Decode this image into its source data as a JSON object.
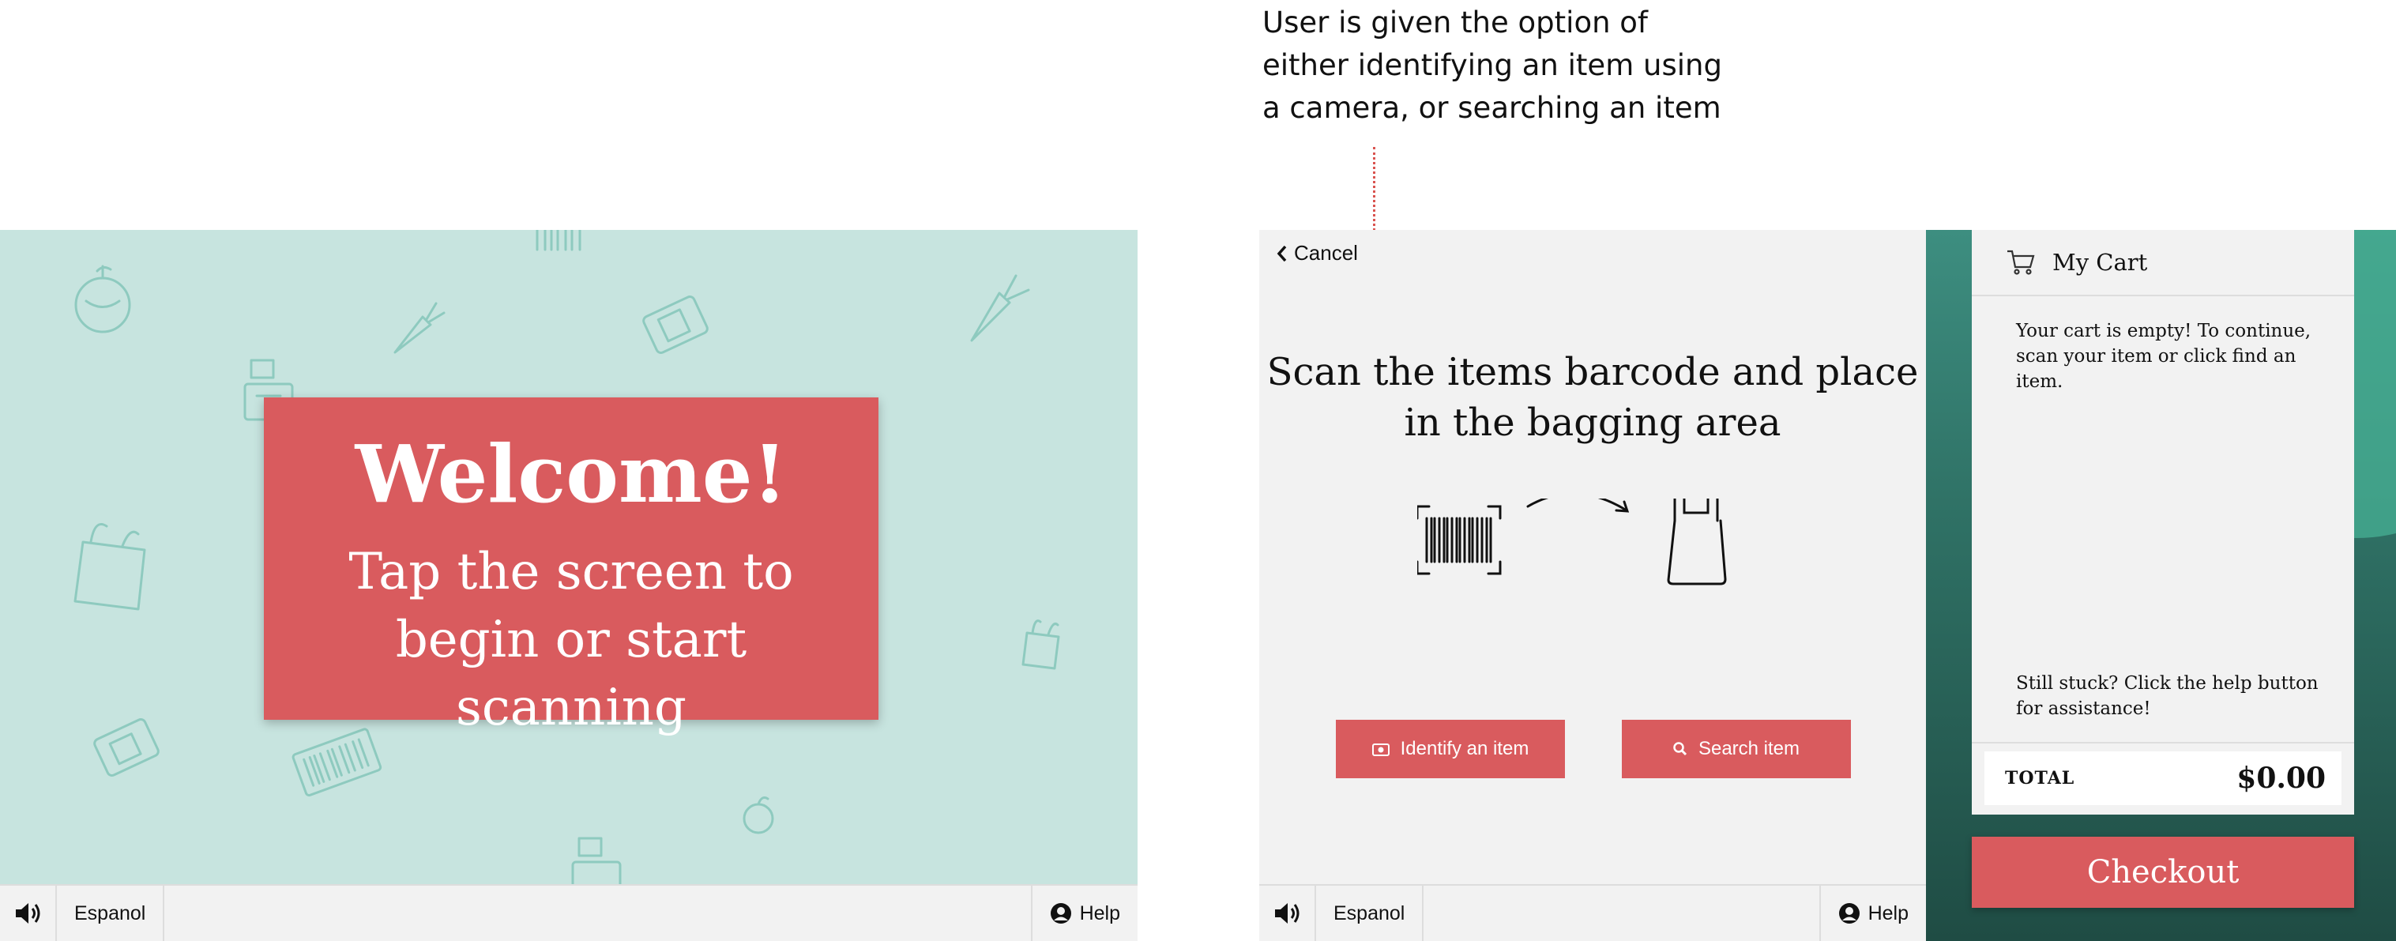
{
  "annotation": {
    "text": "User is given the option of either identifying an item using a camera, or searching an item"
  },
  "welcome_screen": {
    "title": "Welcome!",
    "subtitle": "Tap the screen to begin or start scanning",
    "background_color": "#c7e4df",
    "card_color": "#d95b5e",
    "footer": {
      "language_label": "Espanol",
      "help_label": "Help"
    }
  },
  "scan_screen": {
    "cancel_label": "Cancel",
    "instruction": "Scan the items barcode and place in the bagging area",
    "identify_button_label": "Identify an item",
    "search_button_label": "Search item",
    "accent_color": "#d95b5e",
    "footer": {
      "language_label": "Espanol",
      "help_label": "Help"
    },
    "cart": {
      "title": "My Cart",
      "empty_message": "Your cart is empty! To continue, scan your item or click find an item.",
      "help_message": "Still stuck? Click the help button for assistance!",
      "total_label": "TOTAL",
      "total_amount": "$0.00",
      "checkout_label": "Checkout"
    }
  },
  "icons": [
    "speaker-icon",
    "account-circle-icon",
    "chevron-left-icon",
    "camera-icon",
    "search-icon",
    "cart-icon",
    "barcode-icon",
    "arrow-icon",
    "shopping-bag-icon",
    "orange-icon",
    "carrot-icon",
    "atm-card-icon",
    "cash-register-icon"
  ]
}
